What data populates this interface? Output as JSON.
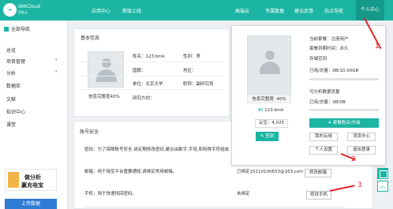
{
  "header": {
    "brand": "SMICloud",
    "brand_sub": "智能云",
    "nav": [
      "应用中心",
      "新版上线",
      "高端云",
      "专属数据",
      "建议反馈",
      "站点导航"
    ],
    "user_center": "个人中心"
  },
  "sidebar": {
    "head": "全部导航",
    "items": [
      "总览",
      "项目管理",
      "分析",
      "数据库",
      "文献",
      "知识中心",
      "课堂"
    ],
    "ad_title1": "做分析",
    "ad_title2": "赢充电宝",
    "ad_bottom": "上传数据"
  },
  "profile": {
    "section_title": "基本信息",
    "completeness": "信息完整度40%",
    "name_label": "姓名：",
    "name": "123.bmk",
    "gender_label": "性别：",
    "gender": "男",
    "country_label": "国籍：",
    "region_label": "地区：",
    "school_label": "单位：",
    "school": "北京大学",
    "title_label": "职称：",
    "title": "副研究员",
    "research_label": "研究方向："
  },
  "security": {
    "section_title": "账号安全",
    "password_label": "密码：",
    "password_desc": "为了保障账号安全,请定期修改密码,建议由数字,字母,和特殊字符组成",
    "email_label": "邮箱：",
    "email_desc": "用于接受平台重要通知,请绑定常用邮箱。",
    "email_value": "已绑定15110100653@163.com",
    "email_btn": "修改邮箱",
    "phone_label": "手机：",
    "phone_desc": "用于快速找回密码。",
    "phone_value": "未绑定",
    "phone_btn": "修改手机"
  },
  "popup": {
    "completeness": "信息完整度: 40%",
    "user_id": "123.bmk",
    "vip_mark": "V\\",
    "cloud_bean": "云豆：4,025",
    "sign_btn": "签到",
    "plan_label": "当前套餐：",
    "plan_value": "注册用户",
    "expire_label": "套餐到期时间：",
    "expire_value": "永久",
    "storage_title": "存储空间",
    "storage_used": "已用/总量：0B/10.00GB",
    "storage_pct": 0,
    "analysis_title": "可分析数据流量",
    "analysis_used": "已用/总量：0B/0B",
    "analysis_pct": 0,
    "upgrade_btn": "套餐购买/升级",
    "my_cloud": "我的云组",
    "messages": "消息中心",
    "settings": "个人设置",
    "logout": "退出登录"
  },
  "annotations": [
    "1",
    "2",
    "3"
  ],
  "colors": {
    "accent": "#1cb5a3",
    "annotation": "#e1262a"
  }
}
